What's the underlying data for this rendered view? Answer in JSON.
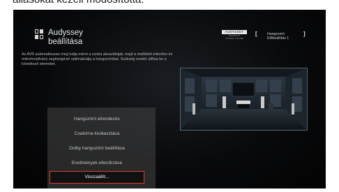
{
  "caption": "állásokat kezeli módosítottá.",
  "header": {
    "title_line1": "Audyssey",
    "title_line2": "beállítása"
  },
  "description": "Az AVR automatikusan meg tudja mérni a szoba akusztikáját, majd a mellékelt mikrofon és mikrofonállvány segítségével optimalizálja a hangszórókat. Szükség esetén állítsa be a következő elemeket.",
  "logo": {
    "badge": "AUDYSSEY",
    "subtext_line1": "MASTER OF",
    "subtext_line2": "DYNAMIC VOLUME"
  },
  "preset": {
    "line1": "Hangszóró",
    "line2": "Előbeállítás 1"
  },
  "menu": {
    "items": [
      "Hangszóró elrendezés",
      "Csatorna kiválasztása",
      "Dolby hangszóró beállítása",
      "Eredmények ellenőrzése",
      "Visszaállít..."
    ],
    "selected_index": 4
  },
  "colors": {
    "selection_border": "#d9412f",
    "background": "#050505"
  }
}
